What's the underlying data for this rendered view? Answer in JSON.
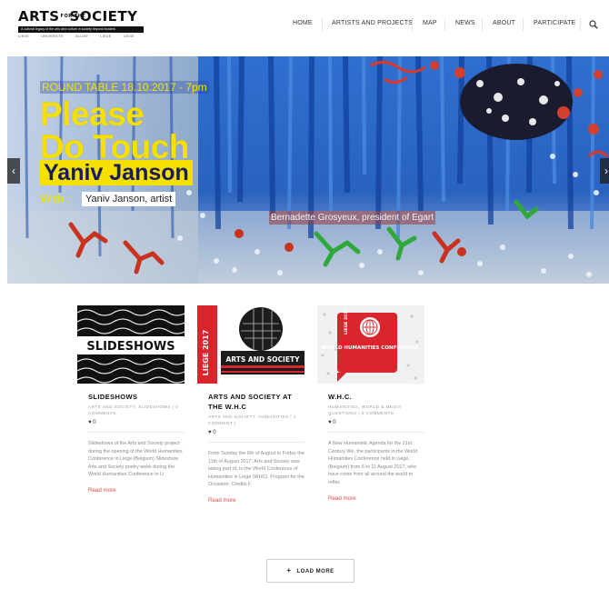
{
  "header": {
    "logo": {
      "left": "ARTS",
      "for": "FOR THE",
      "right": "SOCIETY",
      "tagline": "A cultural legacy of the arts and culture in society beyond borders",
      "partners": [
        "LIEGE",
        "UNIVERSITE ALLIEE",
        "LIEGE",
        "LIEGE"
      ]
    },
    "nav": [
      "HOME",
      "ARTISTS AND PROJECTS",
      "MAP",
      "NEWS",
      "ABOUT",
      "PARTICIPATE"
    ],
    "search_icon": "search-icon"
  },
  "hero": {
    "kicker": "ROUND TABLE 18.10.2017 - 7pm",
    "title_lines": [
      "Please",
      "Do Touch"
    ],
    "name": "Yaniv Janson",
    "with_label": "With :",
    "with_value": "Yaniv Janson, artist",
    "caption": "Bernadette Grosyeux, president of Egart",
    "prev_icon": "chevron-left-icon",
    "next_icon": "chevron-right-icon"
  },
  "posts": [
    {
      "title": "SLIDESHOWS",
      "meta": "ARTS AND SOCIETY, SLIDESHOWS | 0 COMMENTS",
      "likes": "0",
      "excerpt": "Slideshows of the Arts and Society project during the opening of the World Humanities Conference in Liege (Belgium) Slideshow Arts and Society poetry week during the World Humanities Conference in Li",
      "more": "Read more",
      "thumb_text": "SLIDESHOWS"
    },
    {
      "title": "ARTS AND SOCIETY AT THE W.H.C",
      "meta": "ARTS AND SOCIETY, HUMANITIES | 1 COMMENT |",
      "likes": "0",
      "excerpt": "From Sunday the 6th of August to Friday the 11th of August 2017, Arts and Society was taking part of, to the World Conference of Humanities in Liège (WHC). Program for the Occasion: Credits F",
      "more": "Read more",
      "thumb_text": "ARTS AND SOCIETY",
      "thumb_year": "LIEGE 2017"
    },
    {
      "title": "W.H.C.",
      "meta": "HUMANITIES, WORLD & MEDIA QUESTIONS | 0 COMMENTS",
      "likes": "0",
      "excerpt": "A New Humanistic Agenda for the 21st Century We, the participants in the World Humanities Conference held in Liège, (Belgium) from 6 to 11 August 2017, who have come from all around the world to reflec",
      "more": "Read more",
      "thumb_text": "WORLD HUMANITIES CONFERENCE",
      "thumb_year": "LIEGE 2017"
    }
  ],
  "load_more": {
    "label": "LOAD MORE",
    "icon": "plus-icon"
  },
  "colors": {
    "accent_yellow": "#f5e000",
    "read_more": "#d8484e",
    "hero_blue": "#1e5bb8"
  }
}
